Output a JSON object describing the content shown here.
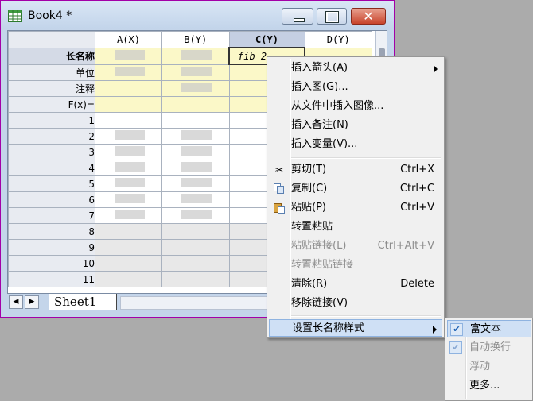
{
  "window": {
    "title": "Book4 *",
    "buttons": {
      "minimize": "",
      "maximize": "",
      "close": "✕"
    }
  },
  "sheet": {
    "columns": [
      "A(X)",
      "B(Y)",
      "C(Y)",
      "D(Y)"
    ],
    "selected_column": "C(Y)",
    "meta_rows": [
      "长名称",
      "单位",
      "注释",
      "F(x)="
    ],
    "row_numbers": [
      "1",
      "2",
      "3",
      "4",
      "5",
      "6",
      "7",
      "8",
      "9",
      "10",
      "11"
    ],
    "editing_cell_text": "fib 2",
    "tab_label": "Sheet1"
  },
  "context_menu": {
    "items": [
      {
        "label": "插入箭头(A)",
        "shortcut": "",
        "submenu": true
      },
      {
        "label": "插入图(G)...",
        "shortcut": ""
      },
      {
        "label": "从文件中插入图像...",
        "shortcut": ""
      },
      {
        "label": "插入备注(N)",
        "shortcut": ""
      },
      {
        "label": "插入变量(V)...",
        "shortcut": ""
      },
      {
        "label": "剪切(T)",
        "shortcut": "Ctrl+X",
        "icon": "scissors-icon"
      },
      {
        "label": "复制(C)",
        "shortcut": "Ctrl+C",
        "icon": "copy-icon"
      },
      {
        "label": "粘贴(P)",
        "shortcut": "Ctrl+V",
        "icon": "paste-icon"
      },
      {
        "label": "转置粘贴",
        "shortcut": ""
      },
      {
        "label": "粘贴链接(L)",
        "shortcut": "Ctrl+Alt+V",
        "disabled": true
      },
      {
        "label": "转置粘贴链接",
        "shortcut": "",
        "disabled": true
      },
      {
        "label": "清除(R)",
        "shortcut": "Delete"
      },
      {
        "label": "移除链接(V)",
        "shortcut": ""
      },
      {
        "label": "设置长名称样式",
        "shortcut": "",
        "submenu": true,
        "highlighted": true
      }
    ]
  },
  "submenu": {
    "items": [
      {
        "label": "富文本",
        "checked": true,
        "highlighted": true
      },
      {
        "label": "自动换行",
        "checked": true,
        "disabled": true
      },
      {
        "label": "浮动",
        "disabled": true
      },
      {
        "label": "更多..."
      }
    ]
  }
}
